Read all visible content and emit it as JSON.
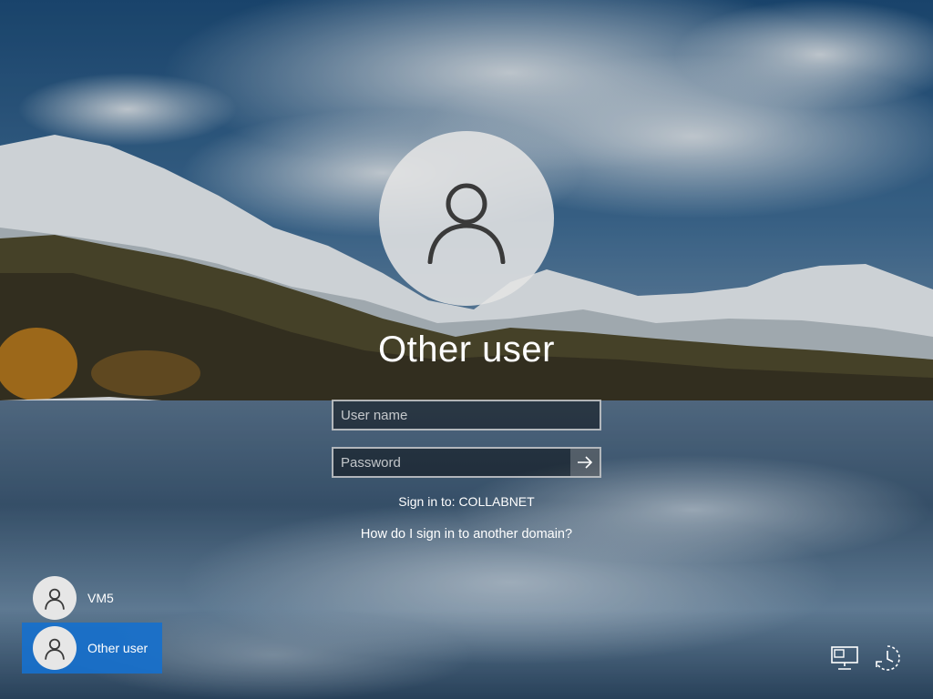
{
  "login": {
    "title": "Other user",
    "username_placeholder": "User name",
    "password_placeholder": "Password",
    "signin_to": "Sign in to: COLLABNET",
    "domain_help_link": "How do I sign in to another domain?",
    "submit_icon": "arrow-right-icon"
  },
  "users": [
    {
      "name": "VM5",
      "selected": false,
      "icon": "user-icon"
    },
    {
      "name": "Other user",
      "selected": true,
      "icon": "user-icon"
    }
  ],
  "system_icons": [
    {
      "name": "network-icon"
    },
    {
      "name": "ease-of-access-icon"
    }
  ],
  "colors": {
    "selected_tile": "#1770CC",
    "text": "#FFFFFF",
    "avatar_bg": "#E4E4E4",
    "avatar_glyph": "#3A3A3A"
  }
}
